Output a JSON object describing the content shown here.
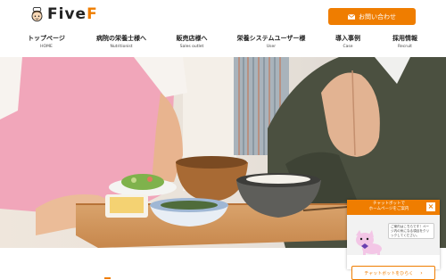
{
  "logo": {
    "text_a": "Five",
    "text_b": "F"
  },
  "header": {
    "contact_label": "お問い合わせ"
  },
  "nav": {
    "items": [
      {
        "jp": "トップページ",
        "en": "HOME"
      },
      {
        "jp": "病院の栄養士様へ",
        "en": "Nutritionist"
      },
      {
        "jp": "販売店様へ",
        "en": "Sales outlet"
      },
      {
        "jp": "栄養システムユーザー様",
        "en": "User"
      },
      {
        "jp": "導入事例",
        "en": "Case"
      },
      {
        "jp": "採用情報",
        "en": "Recruit"
      }
    ]
  },
  "chatbot": {
    "title": "チャットボットで\nホームページをご案内",
    "bubble": "ご案内はこちらです！ページ内の気になる項目をクリックしてください。",
    "button_label": "チャットボットをひらく",
    "close_label": "×"
  },
  "colors": {
    "accent": "#ef7d00"
  }
}
